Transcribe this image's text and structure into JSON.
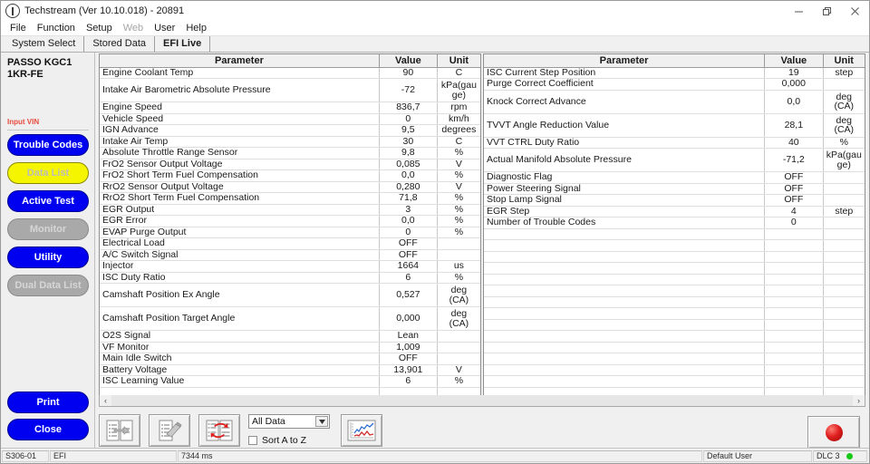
{
  "window": {
    "title": "Techstream (Ver 10.10.018) - 20891",
    "icon": "techstream-icon",
    "buttons": {
      "minimize": "minimize-icon",
      "restore": "restore-icon",
      "close": "close-icon"
    }
  },
  "menu": {
    "items": [
      {
        "label": "File",
        "disabled": false
      },
      {
        "label": "Function",
        "disabled": false
      },
      {
        "label": "Setup",
        "disabled": false
      },
      {
        "label": "Web",
        "disabled": true
      },
      {
        "label": "User",
        "disabled": false
      },
      {
        "label": "Help",
        "disabled": false
      }
    ]
  },
  "tabs": [
    {
      "label": "System Select",
      "active": false
    },
    {
      "label": "Stored Data",
      "active": false
    },
    {
      "label": "EFI Live",
      "active": true
    }
  ],
  "sidebar": {
    "vehicle_line1": "PASSO KGC1",
    "vehicle_line2": "1KR-FE",
    "input_vin": "Input VIN",
    "buttons": [
      {
        "label": "Trouble Codes",
        "style": "blue"
      },
      {
        "label": "Data List",
        "style": "yellow"
      },
      {
        "label": "Active Test",
        "style": "blue"
      },
      {
        "label": "Monitor",
        "style": "gray"
      },
      {
        "label": "Utility",
        "style": "blue"
      },
      {
        "label": "Dual Data List",
        "style": "gray"
      }
    ],
    "bottom_buttons": [
      {
        "label": "Print",
        "style": "blue"
      },
      {
        "label": "Close",
        "style": "blue"
      }
    ]
  },
  "table": {
    "headers": {
      "parameter": "Parameter",
      "value": "Value",
      "unit": "Unit"
    },
    "left_rows": [
      {
        "parameter": "Engine Coolant Temp",
        "value": "90",
        "unit": "C",
        "tall": false
      },
      {
        "parameter": "Intake Air Barometric Absolute Pressure",
        "value": "-72",
        "unit": "kPa(gauge)",
        "tall": true
      },
      {
        "parameter": "Engine Speed",
        "value": "836,7",
        "unit": "rpm",
        "tall": false
      },
      {
        "parameter": "Vehicle Speed",
        "value": "0",
        "unit": "km/h",
        "tall": false
      },
      {
        "parameter": "IGN Advance",
        "value": "9,5",
        "unit": "degrees",
        "tall": false
      },
      {
        "parameter": "Intake Air Temp",
        "value": "30",
        "unit": "C",
        "tall": false
      },
      {
        "parameter": "Absolute Throttle Range Sensor",
        "value": "9,8",
        "unit": "%",
        "tall": false
      },
      {
        "parameter": "FrO2 Sensor Output Voltage",
        "value": "0,085",
        "unit": "V",
        "tall": false
      },
      {
        "parameter": "FrO2 Short Term Fuel Compensation",
        "value": "0,0",
        "unit": "%",
        "tall": false
      },
      {
        "parameter": "RrO2 Sensor Output Voltage",
        "value": "0,280",
        "unit": "V",
        "tall": false
      },
      {
        "parameter": "RrO2 Short Term Fuel Compensation",
        "value": "71,8",
        "unit": "%",
        "tall": false
      },
      {
        "parameter": "EGR Output",
        "value": "3",
        "unit": "%",
        "tall": false
      },
      {
        "parameter": "EGR Error",
        "value": "0,0",
        "unit": "%",
        "tall": false
      },
      {
        "parameter": "EVAP Purge Output",
        "value": "0",
        "unit": "%",
        "tall": false
      },
      {
        "parameter": "Electrical Load",
        "value": "OFF",
        "unit": "",
        "tall": false
      },
      {
        "parameter": "A/C Switch Signal",
        "value": "OFF",
        "unit": "",
        "tall": false
      },
      {
        "parameter": "Injector",
        "value": "1664",
        "unit": "us",
        "tall": false
      },
      {
        "parameter": "ISC Duty Ratio",
        "value": "6",
        "unit": "%",
        "tall": false
      },
      {
        "parameter": "Camshaft Position Ex Angle",
        "value": "0,527",
        "unit": "deg (CA)",
        "tall": true
      },
      {
        "parameter": "Camshaft Position Target Angle",
        "value": "0,000",
        "unit": "deg (CA)",
        "tall": true
      },
      {
        "parameter": "O2S Signal",
        "value": "Lean",
        "unit": "",
        "tall": false
      },
      {
        "parameter": "VF Monitor",
        "value": "1,009",
        "unit": "",
        "tall": false
      },
      {
        "parameter": "Main Idle Switch",
        "value": "OFF",
        "unit": "",
        "tall": false
      },
      {
        "parameter": "Battery Voltage",
        "value": "13,901",
        "unit": "V",
        "tall": false
      },
      {
        "parameter": "ISC Learning Value",
        "value": "6",
        "unit": "%",
        "tall": false
      }
    ],
    "right_rows": [
      {
        "parameter": "ISC Current Step Position",
        "value": "19",
        "unit": "step",
        "tall": false
      },
      {
        "parameter": "Purge Correct Coefficient",
        "value": "0,000",
        "unit": "",
        "tall": false
      },
      {
        "parameter": "Knock Correct Advance",
        "value": "0,0",
        "unit": "deg (CA)",
        "tall": true
      },
      {
        "parameter": "TVVT Angle Reduction Value",
        "value": "28,1",
        "unit": "deg (CA)",
        "tall": true
      },
      {
        "parameter": "VVT CTRL Duty Ratio",
        "value": "40",
        "unit": "%",
        "tall": false
      },
      {
        "parameter": "Actual Manifold Absolute Pressure",
        "value": "-71,2",
        "unit": "kPa(gauge)",
        "tall": true
      },
      {
        "parameter": "Diagnostic Flag",
        "value": "OFF",
        "unit": "",
        "tall": false
      },
      {
        "parameter": "Power Steering Signal",
        "value": "OFF",
        "unit": "",
        "tall": false
      },
      {
        "parameter": "Stop Lamp Signal",
        "value": "OFF",
        "unit": "",
        "tall": false
      },
      {
        "parameter": "EGR Step",
        "value": "4",
        "unit": "step",
        "tall": false
      },
      {
        "parameter": "Number of Trouble Codes",
        "value": "0",
        "unit": "",
        "tall": false
      }
    ]
  },
  "toolbar": {
    "buttons": [
      {
        "name": "select-items-icon"
      },
      {
        "name": "snapshot-icon"
      },
      {
        "name": "reorder-items-icon"
      }
    ],
    "filter_value": "All Data",
    "filter_arrow": "chevron-down-icon",
    "sort_label": "Sort A to Z",
    "sort_checked": false,
    "graph_button": "graph-icon",
    "record_button": "record-icon"
  },
  "scrollbar": {
    "left_arrow": "chevron-left-icon",
    "right_arrow": "chevron-right-icon"
  },
  "statusbar": {
    "code": "S306-01",
    "system": "EFI",
    "timing": "7344 ms",
    "user": "Default User",
    "connection": "DLC 3",
    "status_color": "#16c916"
  },
  "colors": {
    "accent_blue": "#0000f0",
    "accent_yellow": "#f5f500",
    "disabled_gray": "#a9a9a9",
    "vin_red": "#e8493c",
    "record_red": "#e02020"
  }
}
